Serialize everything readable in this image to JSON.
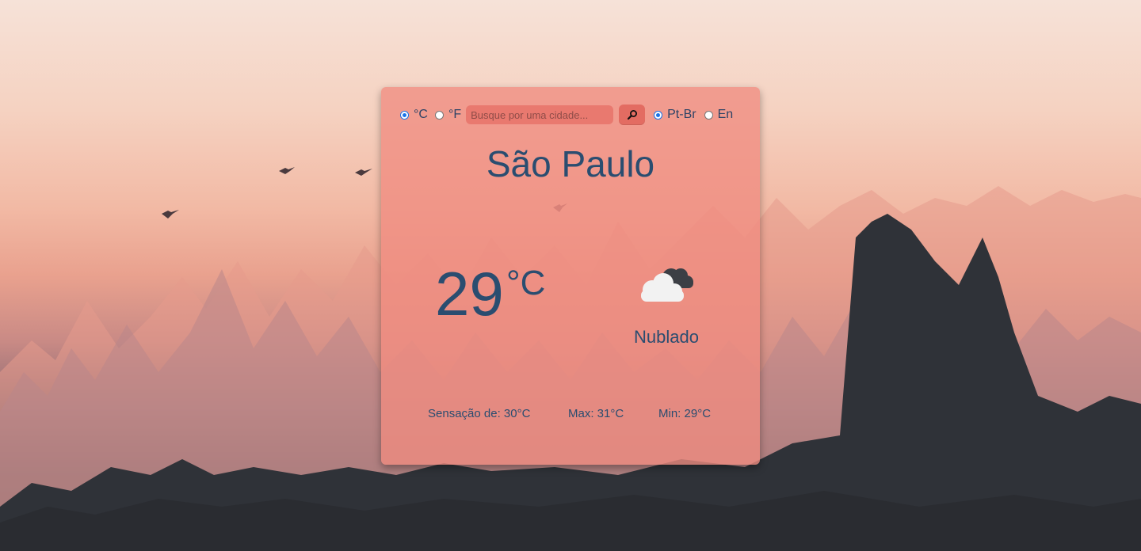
{
  "controls": {
    "celsius_label": "°C",
    "fahrenheit_label": "°F",
    "search_placeholder": "Busque por uma cidade...",
    "search_value": "",
    "selected_unit": "C",
    "lang_ptbr_label": "Pt-Br",
    "lang_en_label": "En",
    "selected_lang": "Pt-Br"
  },
  "weather": {
    "city": "São Paulo",
    "temperature": "29",
    "unit": "°C",
    "condition": "Nublado",
    "icon": "cloudy-icon",
    "feels_like": "Sensação de: 30°C",
    "max": "Max: 31°C",
    "min": "Min: 29°C"
  },
  "colors": {
    "card_bg": "#f08c80",
    "text": "#2a4d70",
    "accent": "#1a73e8"
  }
}
